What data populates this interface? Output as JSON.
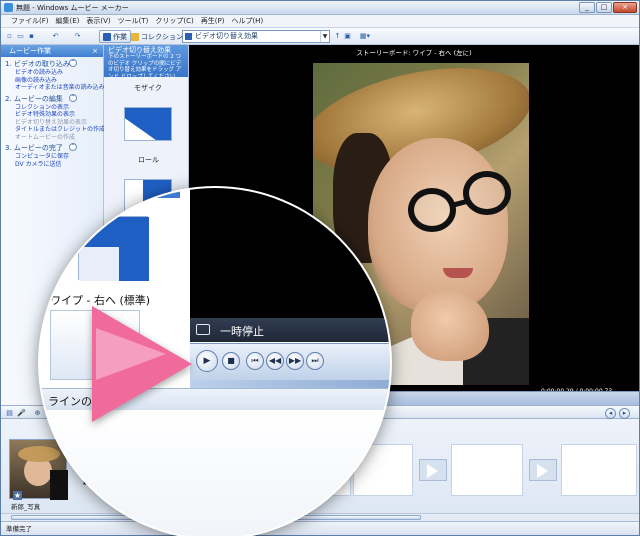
{
  "window": {
    "title": "無題 - Windows ムービー メーカー",
    "controls": [
      "_",
      "□",
      "×"
    ]
  },
  "menu": [
    "ファイル(F)",
    "編集(E)",
    "表示(V)",
    "ツール(T)",
    "クリップ(C)",
    "再生(P)",
    "ヘルプ(H)"
  ],
  "toolbar": {
    "tasks_label": "作業",
    "collections_label": "コレクション",
    "location": "ビデオ切り替え効果"
  },
  "tasks_pane": {
    "title": "ムービー作業",
    "sections": [
      {
        "title": "1. ビデオの取り込み",
        "items": [
          "ビデオの読み込み",
          "画像の読み込み",
          "オーディオまたは音楽の読み込み"
        ]
      },
      {
        "title": "2. ムービーの編集",
        "items": [
          "コレクションの表示",
          "ビデオ特殊効果の表示",
          "ビデオ切り替え効果の表示",
          "タイトルまたはクレジットの作成",
          "オートムービーの作成"
        ]
      },
      {
        "title": "3. ムービーの完了",
        "items": [
          "コンピュータに保存",
          "DV カメラに送信"
        ]
      }
    ]
  },
  "effects_pane": {
    "title": "ビデオ切り替え効果",
    "desc": "下のストーリーボードの 2 つのビデオ クリップの間にビデオ切り替え効果をドラッグ アンド ドロップしてください",
    "items": [
      "モザイク",
      "ロール"
    ]
  },
  "monitor": {
    "title": "ストーリーボード: ワイプ - 右へ (左に)",
    "timecode": "0:00:00.29 / 0:00:00.73"
  },
  "magnified": {
    "effect_label": "ワイプ - 右へ (標準)",
    "status": "一時停止",
    "band_label": "ラインの表示"
  },
  "storyboard": {
    "clip_caption": "新郎_写真"
  },
  "status_bar": "準備完了",
  "colors": {
    "accent_blue": "#3975c8",
    "play_pink": "#f06a9c"
  }
}
